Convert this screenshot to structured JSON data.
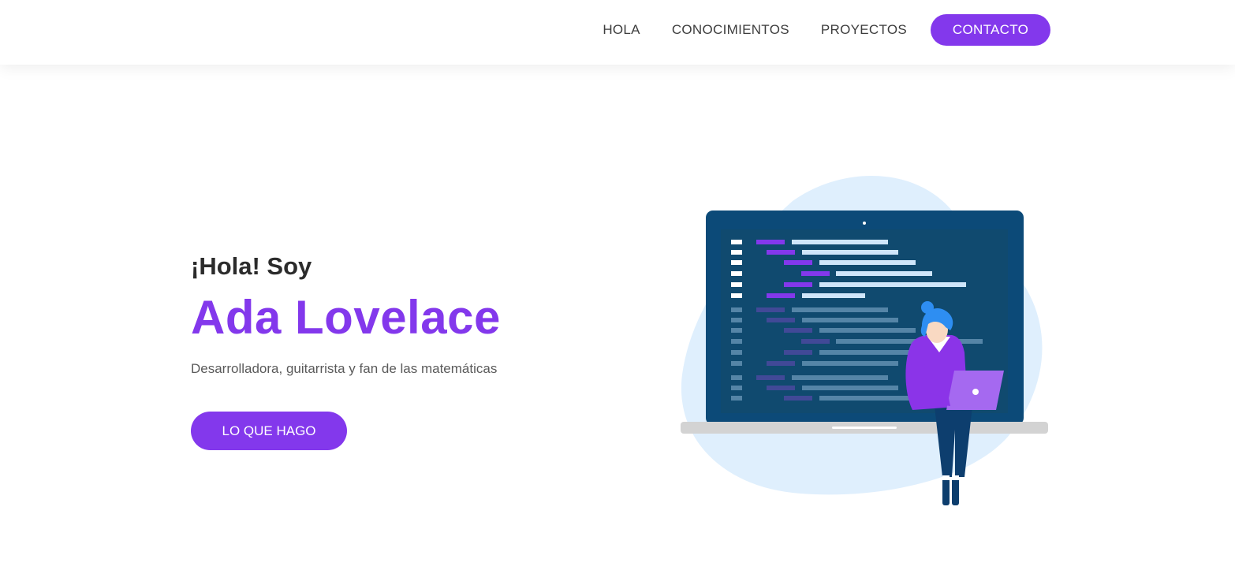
{
  "nav": {
    "items": [
      {
        "label": "HOLA"
      },
      {
        "label": "CONOCIMIENTOS"
      },
      {
        "label": "PROYECTOS"
      }
    ],
    "contact_label": "CONTACTO"
  },
  "hero": {
    "greeting": "¡Hola! Soy",
    "name": "Ada Lovelace",
    "tagline": "Desarrolladora, guitarrista y fan de las matemáticas",
    "cta_label": "LO QUE HAGO"
  },
  "colors": {
    "accent": "#8338ec",
    "text_dark": "#2b2b2b",
    "blob": "#dfeffd",
    "laptop_dark": "#0c4a78",
    "screen": "#104a6f"
  },
  "illustration": {
    "icon": "developer-laptop-illustration"
  }
}
